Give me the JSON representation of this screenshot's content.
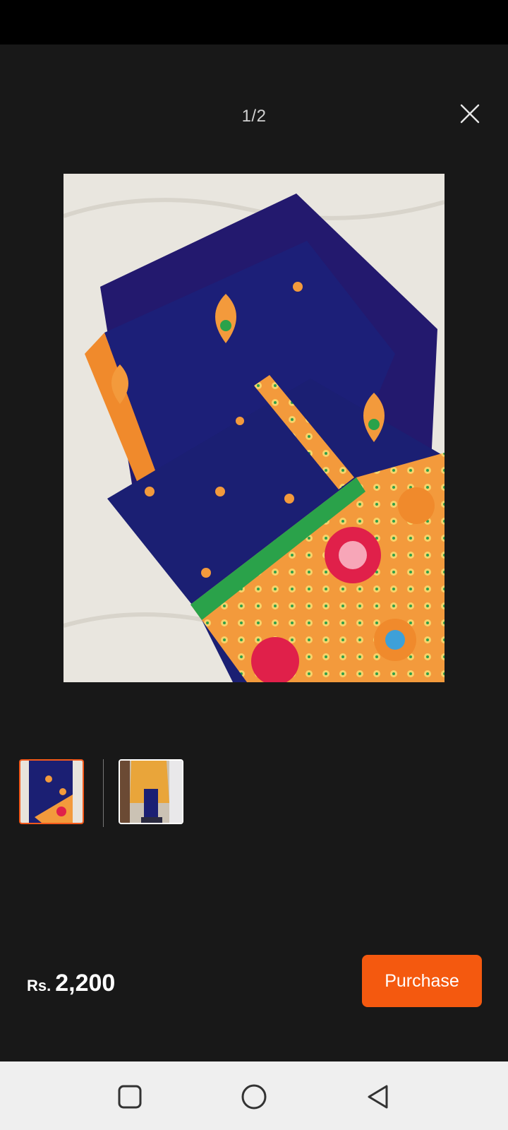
{
  "viewer": {
    "counter": "1/2",
    "close_icon": "close-icon",
    "image_description_colors": {
      "fabric": "#1b1d6b",
      "border": "#f08a2c",
      "accent": "#e0204a",
      "background": "#e8e4dc"
    }
  },
  "thumbnails": [
    {
      "name": "thumbnail-1",
      "active": true
    },
    {
      "name": "thumbnail-2",
      "active": false
    }
  ],
  "footer": {
    "currency": "Rs.",
    "price": "2,200",
    "purchase_label": "Purchase",
    "accent_color": "#f4590f"
  },
  "nav": {
    "recents_icon": "square-icon",
    "home_icon": "circle-icon",
    "back_icon": "triangle-back-icon"
  }
}
